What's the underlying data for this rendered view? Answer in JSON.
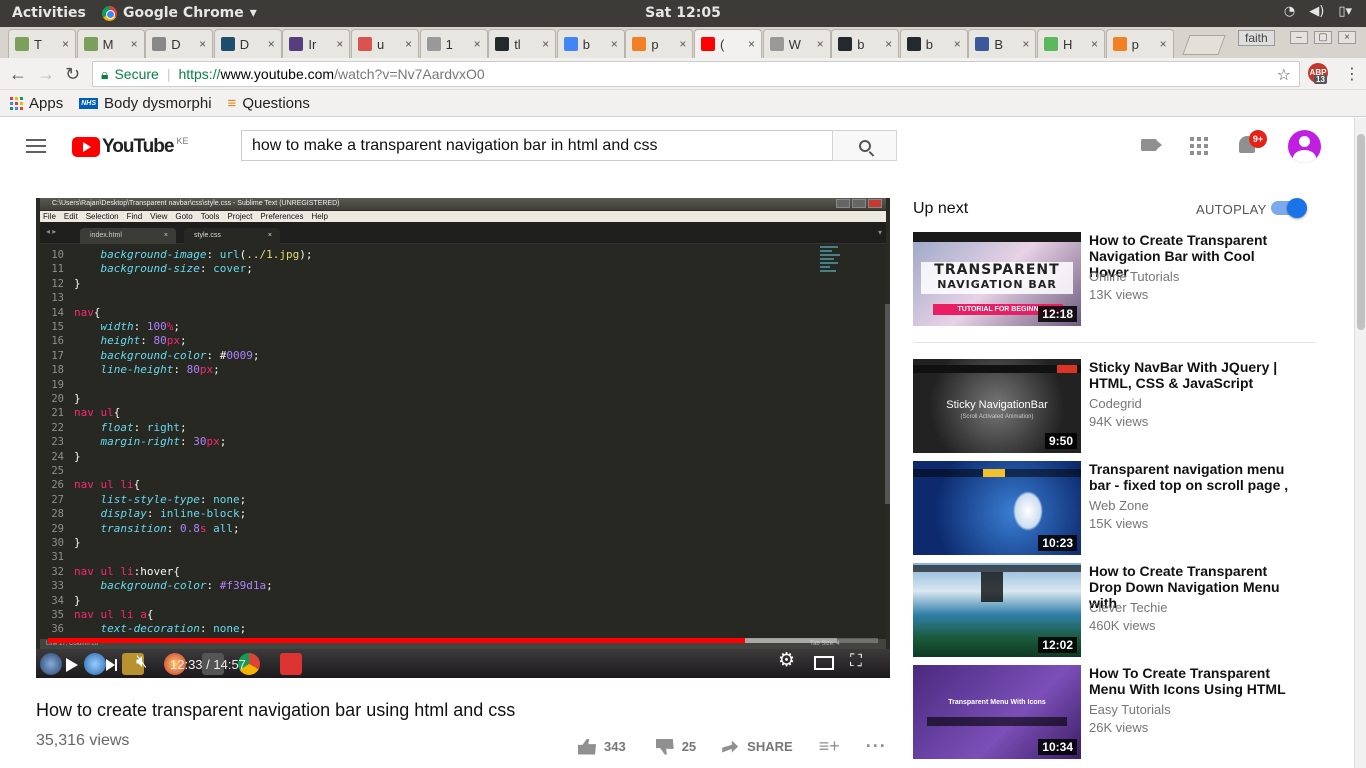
{
  "topbar": {
    "activities": "Activities",
    "app_name": "Google Chrome",
    "clock": "Sat 12:05"
  },
  "tabs": [
    {
      "short": "T",
      "fav_color": "#7ba05b"
    },
    {
      "short": "M",
      "fav_color": "#7ba05b"
    },
    {
      "short": "D",
      "fav_color": "#888888"
    },
    {
      "short": "D",
      "fav_color": "#1c4e6b"
    },
    {
      "short": "Ir",
      "fav_color": "#563d7c"
    },
    {
      "short": "u",
      "fav_color": "#d9534f"
    },
    {
      "short": "1",
      "fav_color": "#999999"
    },
    {
      "short": "tl",
      "fav_color": "#24292e"
    },
    {
      "short": "b",
      "fav_color": "#4285f4"
    },
    {
      "short": "p",
      "fav_color": "#f48024"
    },
    {
      "short": "(",
      "fav_color": "#ff0000"
    },
    {
      "short": "W",
      "fav_color": "#999999"
    },
    {
      "short": "b",
      "fav_color": "#24292e"
    },
    {
      "short": "b",
      "fav_color": "#24292e"
    },
    {
      "short": "B",
      "fav_color": "#3b5998"
    },
    {
      "short": "H",
      "fav_color": "#5cb85c"
    },
    {
      "short": "p",
      "fav_color": "#f48024"
    }
  ],
  "profile": "faith",
  "omnibox": {
    "secure": "Secure",
    "proto": "https://",
    "host": "www.youtube.com",
    "path": "/watch?v=Nv7AardvxO0",
    "adblock_count": "13"
  },
  "bookmarks": [
    {
      "label": "Apps"
    },
    {
      "label": "Body dysmorphi"
    },
    {
      "label": "Questions"
    }
  ],
  "youtube": {
    "country": "KE",
    "logo_text": "YouTube",
    "search_value": "how to make a transparent navigation bar in html and css",
    "notif_badge": "9+",
    "video": {
      "title": "How to create transparent navigation bar using html and css",
      "views": "35,316 views",
      "likes": "343",
      "dislikes": "25",
      "share": "SHARE",
      "time": "12:33 / 14:57",
      "progress": 0.84,
      "buffered": 0.95
    },
    "up_next": "Up next",
    "autoplay": "AUTOPLAY",
    "recs": [
      {
        "title": "How to Create Transparent Navigation Bar with Cool Hover",
        "channel": "Online Tutorials",
        "views": "13K views",
        "dur": "12:18",
        "thumb_big": "TRANSPARENT",
        "thumb_sub": "NAVIGATION BAR",
        "thumb_ribbon": "TUTORIAL FOR BEGINN"
      },
      {
        "title": "Sticky NavBar With JQuery | HTML, CSS & JavaScript",
        "channel": "Codegrid",
        "views": "94K views",
        "dur": "9:50",
        "thumb_big": "Sticky NavigationBar",
        "thumb_sub": "(Scroll Activated Animation)"
      },
      {
        "title": "Transparent navigation menu bar - fixed top on scroll page ,",
        "channel": "Web Zone",
        "views": "15K views",
        "dur": "10:23"
      },
      {
        "title": "How to Create Transparent Drop Down Navigation Menu with",
        "channel": "Clever Techie",
        "views": "460K views",
        "dur": "12:02"
      },
      {
        "title": "How To Create Transparent Menu With Icons Using HTML",
        "channel": "Easy Tutorials",
        "views": "26K views",
        "dur": "10:34",
        "thumb_big": "Transparent Menu With Icons"
      }
    ]
  },
  "sublime": {
    "title": "C:\\Users\\Rajan\\Desktop\\Transparent navbar\\css\\style.css - Sublime Text (UNREGISTERED)",
    "menu": [
      "File",
      "Edit",
      "Selection",
      "Find",
      "View",
      "Goto",
      "Tools",
      "Project",
      "Preferences",
      "Help"
    ],
    "tabs": [
      "index.html",
      "style.css"
    ],
    "status": "Line 17, Column 28",
    "tab_size": "Tab Size: 4",
    "lines": [
      {
        "n": "10",
        "html": "    <span class='prop'>background-image</span><span class='pl'>: </span><span class='val'>url</span><span class='pl'>(</span><span class='str'>../1.jpg</span><span class='pl'>);</span>"
      },
      {
        "n": "11",
        "html": "    <span class='prop'>background-size</span><span class='pl'>: </span><span class='val'>cover</span><span class='pl'>;</span>"
      },
      {
        "n": "12",
        "html": "<span class='pl'>}</span>"
      },
      {
        "n": "13",
        "html": ""
      },
      {
        "n": "14",
        "html": "<span class='sel'>nav</span><span class='pl'>{</span>"
      },
      {
        "n": "15",
        "html": "    <span class='prop'>width</span><span class='pl'>: </span><span class='num'>100</span><span class='unit'>%</span><span class='pl'>;</span>"
      },
      {
        "n": "16",
        "html": "    <span class='prop'>height</span><span class='pl'>: </span><span class='num'>80</span><span class='unit'>px</span><span class='pl'>;</span>"
      },
      {
        "n": "17",
        "html": "    <span class='prop'>background-color</span><span class='pl'>: #</span><span class='num'>0009</span><span class='pl'>;</span>"
      },
      {
        "n": "18",
        "html": "    <span class='prop'>line-height</span><span class='pl'>: </span><span class='num'>80</span><span class='unit'>px</span><span class='pl'>;</span>"
      },
      {
        "n": "19",
        "html": ""
      },
      {
        "n": "20",
        "html": "<span class='pl'>}</span>"
      },
      {
        "n": "21",
        "html": "<span class='sel'>nav ul</span><span class='pl'>{</span>"
      },
      {
        "n": "22",
        "html": "    <span class='prop'>float</span><span class='pl'>: </span><span class='val'>right</span><span class='pl'>;</span>"
      },
      {
        "n": "23",
        "html": "    <span class='prop'>margin-right</span><span class='pl'>: </span><span class='num'>30</span><span class='unit'>px</span><span class='pl'>;</span>"
      },
      {
        "n": "24",
        "html": "<span class='pl'>}</span>"
      },
      {
        "n": "25",
        "html": ""
      },
      {
        "n": "26",
        "html": "<span class='sel'>nav ul li</span><span class='pl'>{</span>"
      },
      {
        "n": "27",
        "html": "    <span class='prop'>list-style-type</span><span class='pl'>: </span><span class='val'>none</span><span class='pl'>;</span>"
      },
      {
        "n": "28",
        "html": "    <span class='prop'>display</span><span class='pl'>: </span><span class='val'>inline-block</span><span class='pl'>;</span>"
      },
      {
        "n": "29",
        "html": "    <span class='prop'>transition</span><span class='pl'>: </span><span class='num'>0.8</span><span class='unit'>s</span><span class='pl'> </span><span class='val'>all</span><span class='pl'>;</span>"
      },
      {
        "n": "30",
        "html": "<span class='pl'>}</span>"
      },
      {
        "n": "31",
        "html": ""
      },
      {
        "n": "32",
        "html": "<span class='sel'>nav ul li</span><span class='pl'>:hover{</span>"
      },
      {
        "n": "33",
        "html": "    <span class='prop'>background-color</span><span class='pl'>: </span><span class='num'>#f39d1a</span><span class='pl'>;</span>"
      },
      {
        "n": "34",
        "html": "<span class='pl'>}</span>"
      },
      {
        "n": "35",
        "html": "<span class='sel'>nav ul li a</span><span class='pl'>{</span>"
      },
      {
        "n": "36",
        "html": "    <span class='prop'>text-decoration</span><span class='pl'>: </span><span class='val'>none</span><span class='pl'>;</span>"
      }
    ]
  }
}
